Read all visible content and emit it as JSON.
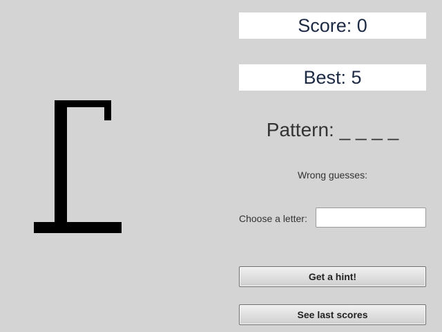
{
  "score": {
    "text": "Score: 0"
  },
  "best": {
    "text": "Best: 5"
  },
  "pattern": {
    "text": "Pattern: _ _ _ _"
  },
  "wrong_guesses": {
    "text": "Wrong guesses:"
  },
  "letter_input": {
    "label": "Choose a letter:",
    "value": ""
  },
  "buttons": {
    "hint": "Get a hint!",
    "last_scores": "See last scores"
  },
  "colors": {
    "background": "#d4d4d4",
    "panel": "#ffffff",
    "gallows": "#000000",
    "score_text": "#1d2a44"
  }
}
